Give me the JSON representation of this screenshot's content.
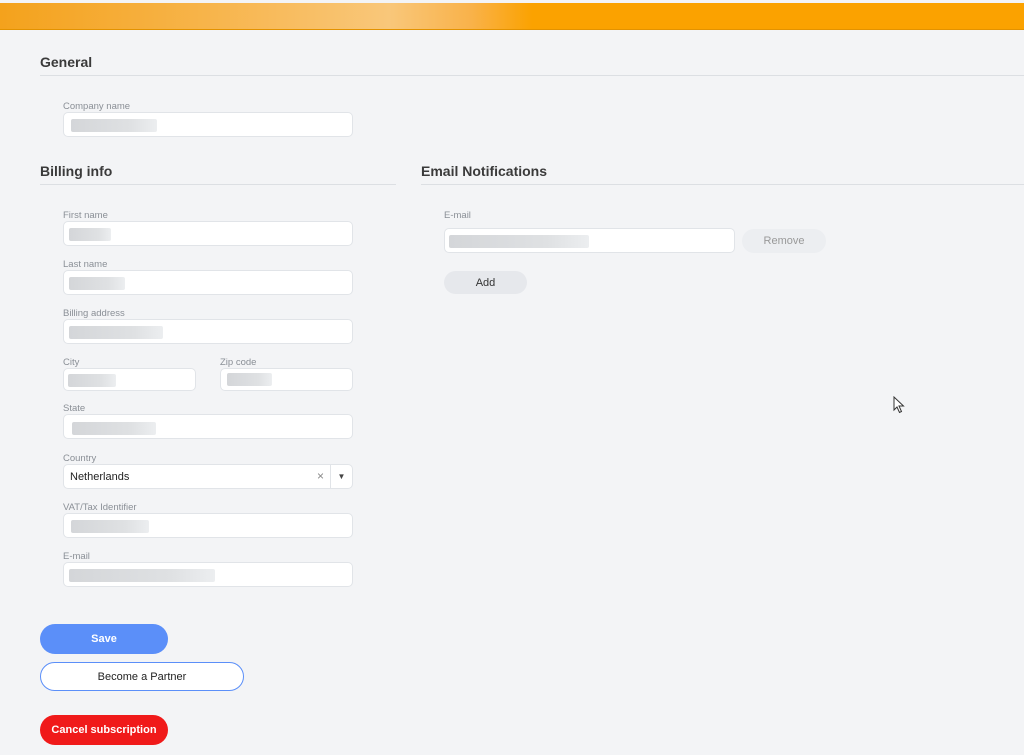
{
  "header": {
    "accent_color": "#fba200"
  },
  "general": {
    "title": "General",
    "company_name_label": "Company name"
  },
  "billing": {
    "title": "Billing info",
    "first_name_label": "First name",
    "last_name_label": "Last name",
    "address_label": "Billing address",
    "city_label": "City",
    "zip_label": "Zip code",
    "state_label": "State",
    "country_label": "Country",
    "country_value": "Netherlands",
    "clear_symbol": "×",
    "caret_symbol": "▼",
    "vat_label": "VAT/Tax Identifier",
    "email_label": "E-mail"
  },
  "notifications": {
    "title": "Email Notifications",
    "email_label": "E-mail",
    "remove_label": "Remove",
    "add_label": "Add"
  },
  "actions": {
    "save_label": "Save",
    "partner_label": "Become a Partner",
    "cancel_label": "Cancel subscription"
  },
  "colors": {
    "primary": "#5b8ff9",
    "danger": "#f01a1a"
  }
}
